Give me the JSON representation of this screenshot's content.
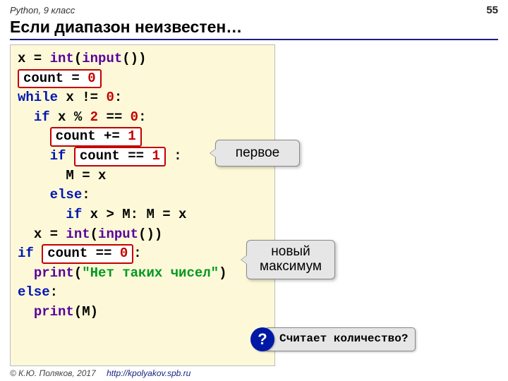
{
  "header": {
    "subject": "Python, 9 класс",
    "page": "55"
  },
  "title": "Если диапазон неизвестен…",
  "code": {
    "l1_a": "x = ",
    "l1_fn1": "int",
    "l1_b": "(",
    "l1_fn2": "input",
    "l1_c": "())",
    "box_count0": "count = ",
    "box_count0_num": "0",
    "l3_kw": "while",
    "l3_mid": " x != ",
    "l3_num": "0",
    "l3_end": ":",
    "l4_pre": "  ",
    "l4_kw": "if",
    "l4_mid": " x % ",
    "l4_n2": "2",
    "l4_eq": " == ",
    "l4_n0": "0",
    "l4_end": ":",
    "l5_pre": "    ",
    "box_countp1": "count += ",
    "box_countp1_num": "1",
    "l6_pre": "    ",
    "l6_kw": "if",
    "l6_sp": " ",
    "box_counteq1": "count == ",
    "box_counteq1_num": "1",
    "l6_end": " :",
    "l7": "      M = x",
    "l8_pre": "    ",
    "l8_kw": "else",
    "l8_end": ":",
    "l9_pre": "      ",
    "l9_kw": "if",
    "l9_rest": " x > M: M = x",
    "l10_pre": "  ",
    "l10_a": "x = ",
    "l10_fn1": "int",
    "l10_b": "(",
    "l10_fn2": "input",
    "l10_c": "())",
    "l11_kw": "if",
    "l11_sp": " ",
    "box_counteq0": "count == ",
    "box_counteq0_num": "0",
    "l11_end": ":",
    "l12_pre": "  ",
    "l12_fn": "print",
    "l12_a": "(",
    "l12_str": "\"Нет таких чисел\"",
    "l12_b": ")",
    "l13_kw": "else",
    "l13_end": ":",
    "l14_pre": "  ",
    "l14_fn": "print",
    "l14_rest": "(M)"
  },
  "callouts": {
    "c1": "первое",
    "c2a": "новый",
    "c2b": "максимум"
  },
  "question": {
    "mark": "?",
    "text": "Считает количество?"
  },
  "footer": {
    "copyright": "© К.Ю. Поляков, 2017",
    "link": "http://kpolyakov.spb.ru"
  }
}
